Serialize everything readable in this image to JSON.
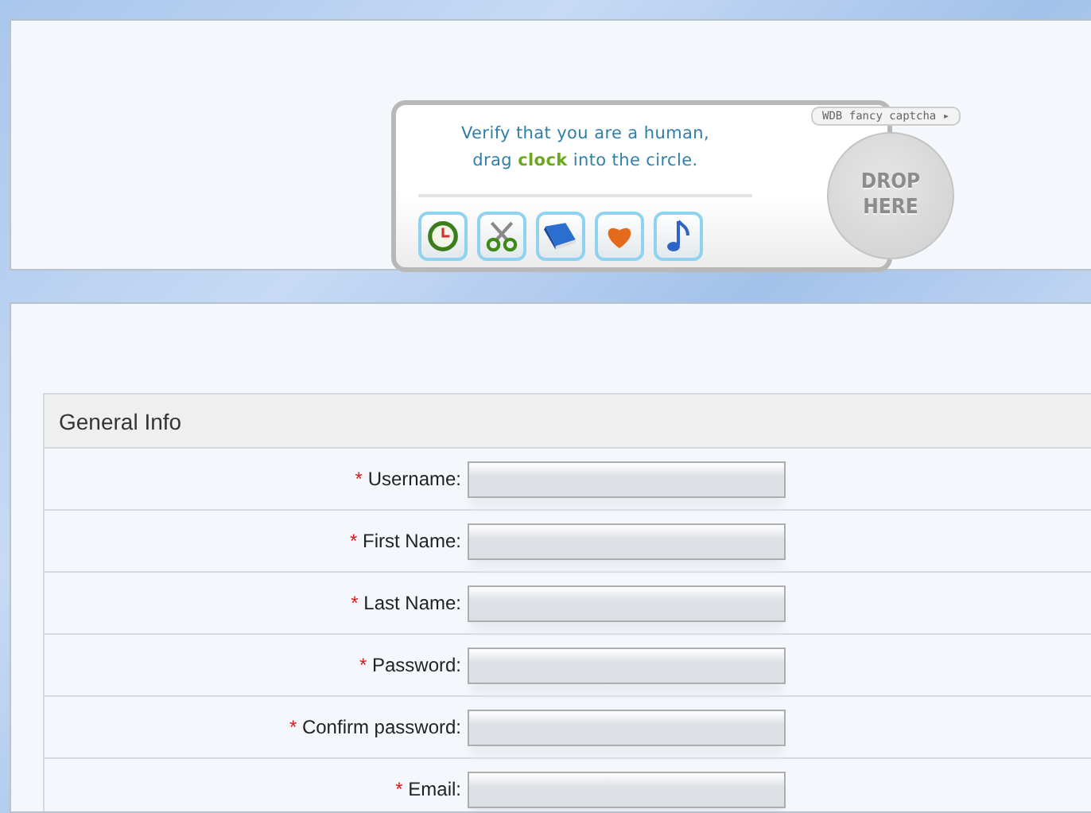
{
  "captcha": {
    "prompt": "Verify that you are a human,\ndrag **clock** into the circle.",
    "brand": "WDB fancy captcha ▸",
    "drop_zone": "DROP\nHERE",
    "items": [
      {
        "kind": "clock"
      },
      {
        "kind": "scissors"
      },
      {
        "kind": "book"
      },
      {
        "kind": "heart"
      },
      {
        "kind": "note"
      }
    ]
  },
  "form": {
    "section": "General Info",
    "fields": [
      {
        "label": "Username:",
        "required_mark": "*"
      },
      {
        "label": "First Name:",
        "required_mark": "*"
      },
      {
        "label": "Last Name:",
        "required_mark": "*"
      },
      {
        "label": "Password:",
        "required_mark": "*"
      },
      {
        "label": "Confirm password:",
        "required_mark": "*"
      },
      {
        "label": "Email:",
        "required_mark": "*"
      }
    ]
  }
}
